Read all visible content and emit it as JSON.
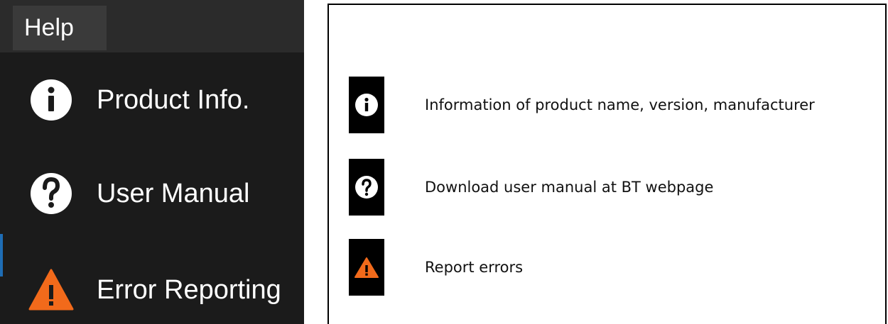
{
  "menu": {
    "title": "Help",
    "items": [
      {
        "label": "Product Info.",
        "icon": "info-icon"
      },
      {
        "label": "User Manual",
        "icon": "question-icon"
      },
      {
        "label": "Error Reporting",
        "icon": "warning-icon"
      }
    ]
  },
  "legend": {
    "rows": [
      {
        "icon": "info-icon",
        "text": "Information of product name, version, manufacturer"
      },
      {
        "icon": "question-icon",
        "text": "Download user manual at BT webpage"
      },
      {
        "icon": "warning-icon",
        "text": "Report errors"
      }
    ]
  },
  "colors": {
    "menu_background": "#1b1b1b",
    "menu_bar": "#2b2b2b",
    "warning_orange": "#f26a1b",
    "icon_white": "#ffffff"
  }
}
